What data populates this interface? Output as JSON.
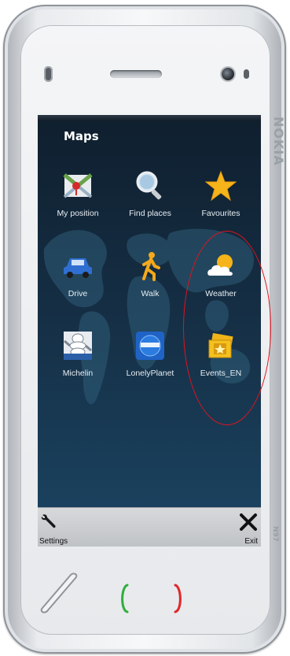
{
  "device": {
    "brand": "NOKIA",
    "model": "N97"
  },
  "screen": {
    "title": "Maps",
    "apps": [
      {
        "label": "My position",
        "icon": "map-pin-icon"
      },
      {
        "label": "Find places",
        "icon": "magnifier-icon"
      },
      {
        "label": "Favourites",
        "icon": "star-icon"
      },
      {
        "label": "Drive",
        "icon": "car-icon"
      },
      {
        "label": "Walk",
        "icon": "walking-person-icon"
      },
      {
        "label": "Weather",
        "icon": "weather-cloud-sun-icon"
      },
      {
        "label": "Michelin",
        "icon": "michelin-man-icon"
      },
      {
        "label": "LonelyPlanet",
        "icon": "lonely-planet-icon"
      },
      {
        "label": "Events_EN",
        "icon": "event-tickets-icon"
      }
    ]
  },
  "softkeys": {
    "left_label": "Settings",
    "right_label": "Exit"
  },
  "colors": {
    "highlight": "#e0141e",
    "call_key": "#2fae3c",
    "end_key": "#e0262a"
  }
}
